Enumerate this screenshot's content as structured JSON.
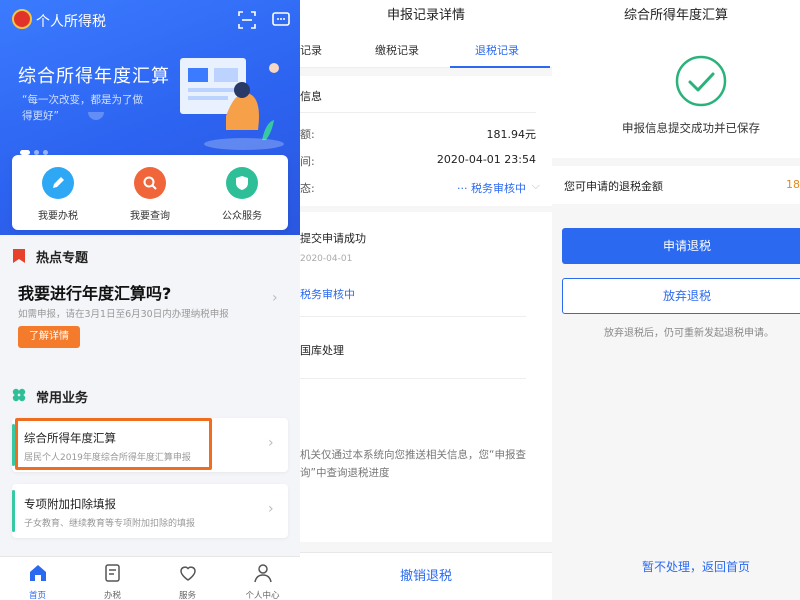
{
  "colors": {
    "primary": "#2b6af0",
    "success": "#2ab27b",
    "orange": "#f37b2b",
    "highlight": "#f06d1f",
    "teal": "#37c8a4"
  },
  "home": {
    "app_title": "个人所得税",
    "icons": [
      "emblem-icon",
      "scan-icon",
      "message-icon"
    ],
    "banner": {
      "title": "综合所得年度汇算",
      "subtitle": "“每一次改变，都是为了做得更好”"
    },
    "quick_actions": [
      {
        "label": "我要办税",
        "icon": "pen-icon",
        "color": "#2ea8f5"
      },
      {
        "label": "我要查询",
        "icon": "search-icon",
        "color": "#f0663a"
      },
      {
        "label": "公众服务",
        "icon": "shield-icon",
        "color": "#2fbf98"
      }
    ],
    "hot": {
      "section_title": "热点专题",
      "headline": "我要进行年度汇算吗?",
      "description": "如需申报，请在3月1日至6月30日内办理纳税申报",
      "button": "了解详情"
    },
    "common": {
      "section_title": "常用业务",
      "items": [
        {
          "title": "综合所得年度汇算",
          "description": "居民个人2019年度综合所得年度汇算申报"
        },
        {
          "title": "专项附加扣除填报",
          "description": "子女教育、继续教育等专项附加扣除的填报"
        }
      ]
    },
    "tabbar": [
      {
        "label": "首页",
        "icon": "home-icon",
        "active": true
      },
      {
        "label": "办税",
        "icon": "form-icon",
        "active": false
      },
      {
        "label": "服务",
        "icon": "heart-icon",
        "active": false
      },
      {
        "label": "个人中心",
        "icon": "user-icon",
        "active": false
      }
    ]
  },
  "record": {
    "title": "申报记录详情",
    "tabs": [
      "记录",
      "缴税记录",
      "退税记录"
    ],
    "active_tab": "退税记录",
    "info_header": "信息",
    "rows": [
      {
        "key": "额:",
        "value": "181.94元"
      },
      {
        "key": "间:",
        "value": "2020-04-01 23:54"
      },
      {
        "key": "态:",
        "value": "··· 税务审核中"
      }
    ],
    "timeline": [
      {
        "title": "提交申请成功",
        "date": "2020-04-01"
      },
      {
        "title": "税务审核中"
      },
      {
        "title": "国库处理"
      }
    ],
    "notice": "机关仅通过本系统向您推送相关信息，您“申报查询”中查询退税进度",
    "bottom_button": "撤销退税"
  },
  "result": {
    "title": "综合所得年度汇算",
    "success_text": "申报信息提交成功并已保存",
    "refund_label": "您可申请的退税金额",
    "refund_amount": "18",
    "apply_button": "申请退税",
    "abandon_button": "放弃退税",
    "hint": "放弃退税后，仍可重新发起退税申请。",
    "return_link": "暂不处理，返回首页"
  }
}
